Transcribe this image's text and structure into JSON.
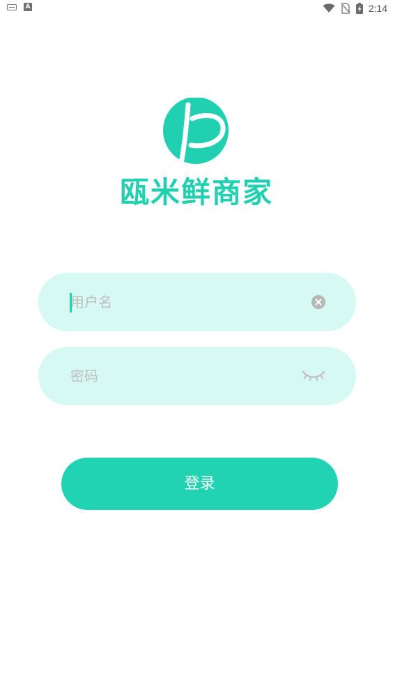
{
  "status_bar": {
    "left_icons": [
      "keyboard-icon",
      "a-notification-icon"
    ],
    "right_icons": [
      "wifi-icon",
      "no-sim-icon",
      "battery-charging-icon"
    ],
    "time": "2:14",
    "a_icon_label": "A"
  },
  "brand": {
    "name": "瓯米鲜商家",
    "logo_icon": "brand-logo-icon",
    "color": "#21d0b1"
  },
  "form": {
    "username": {
      "placeholder": "用户名",
      "value": "",
      "clear_icon": "clear-icon"
    },
    "password": {
      "placeholder": "密码",
      "value": "",
      "visibility_icon": "eye-closed-icon"
    },
    "submit_label": "登录"
  },
  "colors": {
    "accent": "#21d3b3",
    "field_background": "#d6faf3",
    "placeholder": "#bdbdbd"
  }
}
